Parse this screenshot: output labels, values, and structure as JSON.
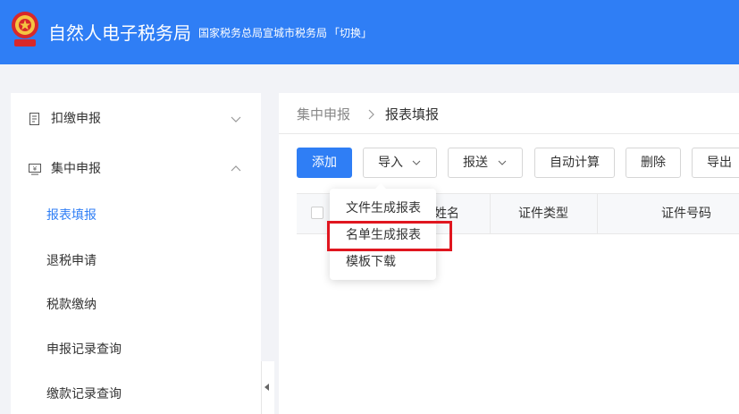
{
  "header": {
    "app_title": "自然人电子税务局",
    "office": "国家税务总局宣城市税务局",
    "switch_label": "「切换」",
    "bg_color": "#2f7ef5"
  },
  "sidebar": {
    "groups": [
      {
        "label": "扣缴申报",
        "icon": "document-icon",
        "state": "collapsed"
      },
      {
        "label": "集中申报",
        "icon": "yuan-monitor-icon",
        "state": "expanded"
      }
    ],
    "sub_items": [
      {
        "label": "报表填报",
        "active": true
      },
      {
        "label": "退税申请",
        "active": false
      },
      {
        "label": "税款缴纳",
        "active": false
      },
      {
        "label": "申报记录查询",
        "active": false
      },
      {
        "label": "缴款记录查询",
        "active": false
      }
    ]
  },
  "breadcrumb": {
    "parent": "集中申报",
    "current": "报表填报"
  },
  "toolbar": {
    "add": "添加",
    "import": "导入",
    "submit": "报送",
    "auto_calc": "自动计算",
    "delete": "删除",
    "export": "导出"
  },
  "table": {
    "headers": [
      "姓名",
      "证件类型",
      "证件号码"
    ]
  },
  "import_menu": {
    "items": [
      "文件生成报表",
      "名单生成报表",
      "模板下载"
    ],
    "highlighted": "名单生成报表"
  },
  "colors": {
    "accent": "#2f7ef5",
    "highlight": "#e0161f"
  }
}
